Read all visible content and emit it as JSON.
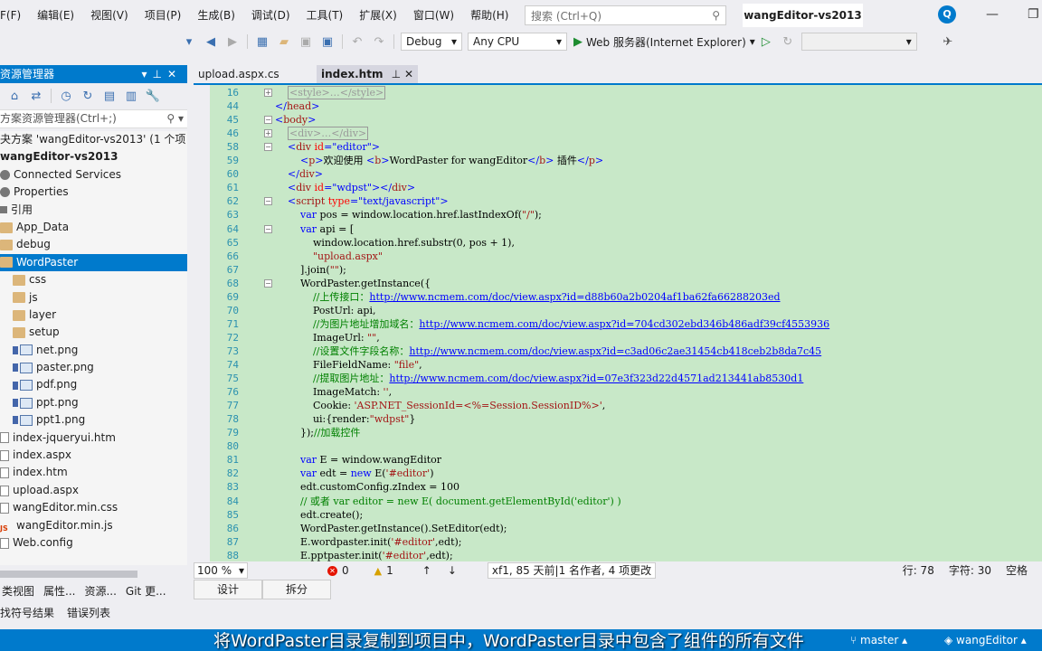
{
  "menu": [
    "F(F)",
    "编辑(E)",
    "视图(V)",
    "项目(P)",
    "生成(B)",
    "调试(D)",
    "工具(T)",
    "扩展(X)",
    "窗口(W)",
    "帮助(H)"
  ],
  "search": {
    "placeholder": "搜索 (Ctrl+Q)"
  },
  "window_title": "wangEditor-vs2013",
  "user_initial": "Q",
  "toolbar": {
    "config": "Debug",
    "platform": "Any CPU",
    "run_label": "Web 服务器(Internet Explorer)"
  },
  "solution": {
    "header": "资源管理器",
    "search_placeholder": "方案资源管理器(Ctrl+;)",
    "items": [
      {
        "label": "夬方案 'wangEditor-vs2013' (1 个项目",
        "icon": "none",
        "indent": 0,
        "bold": false
      },
      {
        "label": "wangEditor-vs2013",
        "icon": "none",
        "indent": 0,
        "bold": true
      },
      {
        "label": "Connected Services",
        "icon": "gear",
        "indent": 1,
        "bold": false
      },
      {
        "label": "Properties",
        "icon": "gear",
        "indent": 1,
        "bold": false
      },
      {
        "label": "引用",
        "icon": "ref",
        "indent": 1,
        "bold": false
      },
      {
        "label": "App_Data",
        "icon": "folder",
        "indent": 1,
        "bold": false
      },
      {
        "label": "debug",
        "icon": "folder",
        "indent": 1,
        "bold": false
      },
      {
        "label": "WordPaster",
        "icon": "folder",
        "indent": 1,
        "bold": false,
        "selected": true
      },
      {
        "label": "css",
        "icon": "folder",
        "indent": 2,
        "bold": false
      },
      {
        "label": "js",
        "icon": "folder",
        "indent": 2,
        "bold": false
      },
      {
        "label": "layer",
        "icon": "folder",
        "indent": 2,
        "bold": false
      },
      {
        "label": "setup",
        "icon": "folder",
        "indent": 2,
        "bold": false
      },
      {
        "label": "net.png",
        "icon": "img",
        "indent": 2,
        "bold": false
      },
      {
        "label": "paster.png",
        "icon": "img",
        "indent": 2,
        "bold": false
      },
      {
        "label": "pdf.png",
        "icon": "img",
        "indent": 2,
        "bold": false
      },
      {
        "label": "ppt.png",
        "icon": "img",
        "indent": 2,
        "bold": false
      },
      {
        "label": "ppt1.png",
        "icon": "img",
        "indent": 2,
        "bold": false
      },
      {
        "label": "index-jqueryui.htm",
        "icon": "file",
        "indent": 1,
        "bold": false
      },
      {
        "label": "index.aspx",
        "icon": "file",
        "indent": 1,
        "bold": false
      },
      {
        "label": "index.htm",
        "icon": "file",
        "indent": 1,
        "bold": false
      },
      {
        "label": "upload.aspx",
        "icon": "file",
        "indent": 1,
        "bold": false
      },
      {
        "label": "wangEditor.min.css",
        "icon": "file",
        "indent": 1,
        "bold": false
      },
      {
        "label": "wangEditor.min.js",
        "icon": "js",
        "indent": 1,
        "bold": false
      },
      {
        "label": "Web.config",
        "icon": "file",
        "indent": 1,
        "bold": false
      }
    ],
    "bottom_tabs": [
      "类视图",
      "属性...",
      "资源...",
      "Git 更..."
    ],
    "bottom_tabs2": [
      "找符号结果",
      "错误列表"
    ]
  },
  "tabs": [
    {
      "label": "upload.aspx.cs",
      "active": true
    },
    {
      "label": "index.htm",
      "active": false
    }
  ],
  "code_lines": [
    {
      "n": "16",
      "fold": "+",
      "html": "    <span class='t-boxed'>&lt;style&gt;…&lt;/style&gt;</span>"
    },
    {
      "n": "44",
      "fold": "",
      "html": "<span class='t-str'>&lt;/</span><span class='t-tag'>head</span><span class='t-str'>&gt;</span>"
    },
    {
      "n": "45",
      "fold": "-",
      "html": "<span class='t-str'>&lt;</span><span class='t-tag'>body</span><span class='t-str'>&gt;</span>"
    },
    {
      "n": "46",
      "fold": "+",
      "html": "    <span class='t-boxed'>&lt;div&gt;…&lt;/div&gt;</span>"
    },
    {
      "n": "58",
      "fold": "-",
      "html": "    <span class='t-str'>&lt;</span><span class='t-tag'>div</span> <span class='t-attr'>id</span><span class='t-str'>=\"editor\"&gt;</span>"
    },
    {
      "n": "59",
      "fold": "",
      "html": "        <span class='t-str'>&lt;</span><span class='t-tag'>p</span><span class='t-str'>&gt;</span>欢迎使用 <span class='t-str'>&lt;</span><span class='t-tag'>b</span><span class='t-str'>&gt;</span>WordPaster for wangEditor<span class='t-str'>&lt;/</span><span class='t-tag'>b</span><span class='t-str'>&gt;</span> 插件<span class='t-str'>&lt;/</span><span class='t-tag'>p</span><span class='t-str'>&gt;</span>"
    },
    {
      "n": "60",
      "fold": "",
      "html": "    <span class='t-str'>&lt;/</span><span class='t-tag'>div</span><span class='t-str'>&gt;</span>"
    },
    {
      "n": "61",
      "fold": "",
      "html": "    <span class='t-str'>&lt;</span><span class='t-tag'>div</span> <span class='t-attr'>id</span><span class='t-str'>=\"wdpst\"&gt;&lt;/</span><span class='t-tag'>div</span><span class='t-str'>&gt;</span>"
    },
    {
      "n": "62",
      "fold": "-",
      "html": "    <span class='t-str'>&lt;</span><span class='t-tag'>script</span> <span class='t-attr'>type</span><span class='t-str'>=\"text/javascript\"&gt;</span>"
    },
    {
      "n": "63",
      "fold": "",
      "html": "        <span class='t-kw'>var</span> pos = window.location.href.lastIndexOf(<span class='t-jsstr'>\"/\"</span>);"
    },
    {
      "n": "64",
      "fold": "-",
      "html": "        <span class='t-kw'>var</span> api = ["
    },
    {
      "n": "65",
      "fold": "",
      "html": "            window.location.href.substr(0, pos + 1),"
    },
    {
      "n": "66",
      "fold": "",
      "html": "            <span class='t-jsstr'>\"upload.aspx\"</span>"
    },
    {
      "n": "67",
      "fold": "",
      "html": "        ].join(<span class='t-jsstr'>\"\"</span>);"
    },
    {
      "n": "68",
      "fold": "-",
      "html": "        WordPaster.getInstance({"
    },
    {
      "n": "69",
      "fold": "",
      "html": "            <span class='t-cm'>//上传接口：</span><span class='t-link'>http://www.ncmem.com/doc/view.aspx?id=d88b60a2b0204af1ba62fa66288203ed</span>"
    },
    {
      "n": "70",
      "fold": "",
      "html": "            PostUrl: api,"
    },
    {
      "n": "71",
      "fold": "",
      "html": "            <span class='t-cm'>//为图片地址增加域名：</span><span class='t-link'>http://www.ncmem.com/doc/view.aspx?id=704cd302ebd346b486adf39cf4553936</span>"
    },
    {
      "n": "72",
      "fold": "",
      "html": "            ImageUrl: <span class='t-jsstr'>\"\"</span>,"
    },
    {
      "n": "73",
      "fold": "",
      "html": "            <span class='t-cm'>//设置文件字段名称：</span><span class='t-link'>http://www.ncmem.com/doc/view.aspx?id=c3ad06c2ae31454cb418ceb2b8da7c45</span>"
    },
    {
      "n": "74",
      "fold": "",
      "html": "            FileFieldName: <span class='t-jsstr'>\"file\"</span>,"
    },
    {
      "n": "75",
      "fold": "",
      "html": "            <span class='t-cm'>//提取图片地址：</span><span class='t-link'>http://www.ncmem.com/doc/view.aspx?id=07e3f323d22d4571ad213441ab8530d1</span>"
    },
    {
      "n": "76",
      "fold": "",
      "html": "            ImageMatch: <span class='t-jsstr'>''</span>,"
    },
    {
      "n": "77",
      "fold": "",
      "html": "            Cookie: <span class='t-jsstr'>'ASP.NET_SessionId=&lt;%=Session.SessionID%&gt;'</span>,"
    },
    {
      "n": "78",
      "fold": "",
      "html": "            ui:{render:<span class='t-jsstr'>\"wdpst\"</span>}"
    },
    {
      "n": "79",
      "fold": "",
      "html": "        });<span class='t-cm'>//加载控件</span>"
    },
    {
      "n": "80",
      "fold": "",
      "html": ""
    },
    {
      "n": "81",
      "fold": "",
      "html": "        <span class='t-kw'>var</span> E = window.wangEditor"
    },
    {
      "n": "82",
      "fold": "",
      "html": "        <span class='t-kw'>var</span> edt = <span class='t-kw'>new</span> E(<span class='t-jsstr'>'#editor'</span>)"
    },
    {
      "n": "83",
      "fold": "",
      "html": "        edt.customConfig.zIndex = 100"
    },
    {
      "n": "84",
      "fold": "",
      "html": "        <span class='t-cm'>// 或者 var editor = new E( document.getElementById('editor') )</span>"
    },
    {
      "n": "85",
      "fold": "",
      "html": "        edt.create();"
    },
    {
      "n": "86",
      "fold": "",
      "html": "        WordPaster.getInstance().SetEditor(edt);"
    },
    {
      "n": "87",
      "fold": "",
      "html": "        E.wordpaster.init(<span class='t-jsstr'>'#editor'</span>,edt);"
    },
    {
      "n": "88",
      "fold": "",
      "html": "        E.pptpaster.init(<span class='t-jsstr'>'#editor'</span>,edt);"
    }
  ],
  "editor_status": {
    "zoom": "100 %",
    "errors": "0",
    "warnings": "1",
    "git": "xf1, 85 天前|1 名作者, 4 项更改",
    "line": "行: 78",
    "col": "字符: 30",
    "mode": "空格"
  },
  "view_tabs": [
    "设计",
    "拆分"
  ],
  "statusbar": {
    "subtitle": "将WordPaster目录复制到项目中，WordPaster目录中包含了组件的所有文件",
    "branch": "master",
    "repo": "wangEditor"
  }
}
